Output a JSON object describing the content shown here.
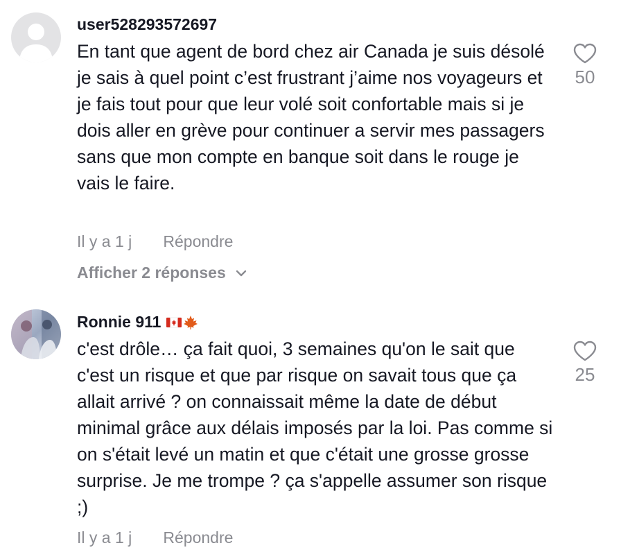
{
  "comments": [
    {
      "username": "user528293572697",
      "text": "En tant que agent de bord chez air Canada je suis désolé je sais à quel point c’est frustrant j’aime nos voyageurs et je fais tout pour que leur volé soit confortable mais si je dois aller en grève pour continuer a servir mes passagers sans que mon compte en banque soit dans le rouge je vais le faire.",
      "time": "Il y a 1 j",
      "reply_label": "Répondre",
      "view_replies_label": "Afficher 2 réponses",
      "likes": "50",
      "avatar": "default-avatar"
    },
    {
      "username": "Ronnie 911",
      "username_emojis": [
        "canada-flag-icon",
        "maple-leaf-icon"
      ],
      "text": "c'est drôle… ça fait quoi, 3 semaines qu'on le sait que c'est un risque et que par risque on savait tous que ça allait arrivé ? on connaissait même la date de début minimal grâce aux délais imposés par la loi. Pas comme si on s'était levé un matin et que c'était une grosse grosse surprise. Je me trompe ? ça s'appelle assumer son risque ;)",
      "time": "Il y a 1 j",
      "reply_label": "Répondre",
      "likes": "25",
      "avatar": "photo-avatar"
    }
  ],
  "colors": {
    "text": "#161823",
    "muted": "#8a8b91",
    "default_avatar_bg": "#e3e3e5",
    "default_avatar_fg": "#ffffff"
  }
}
